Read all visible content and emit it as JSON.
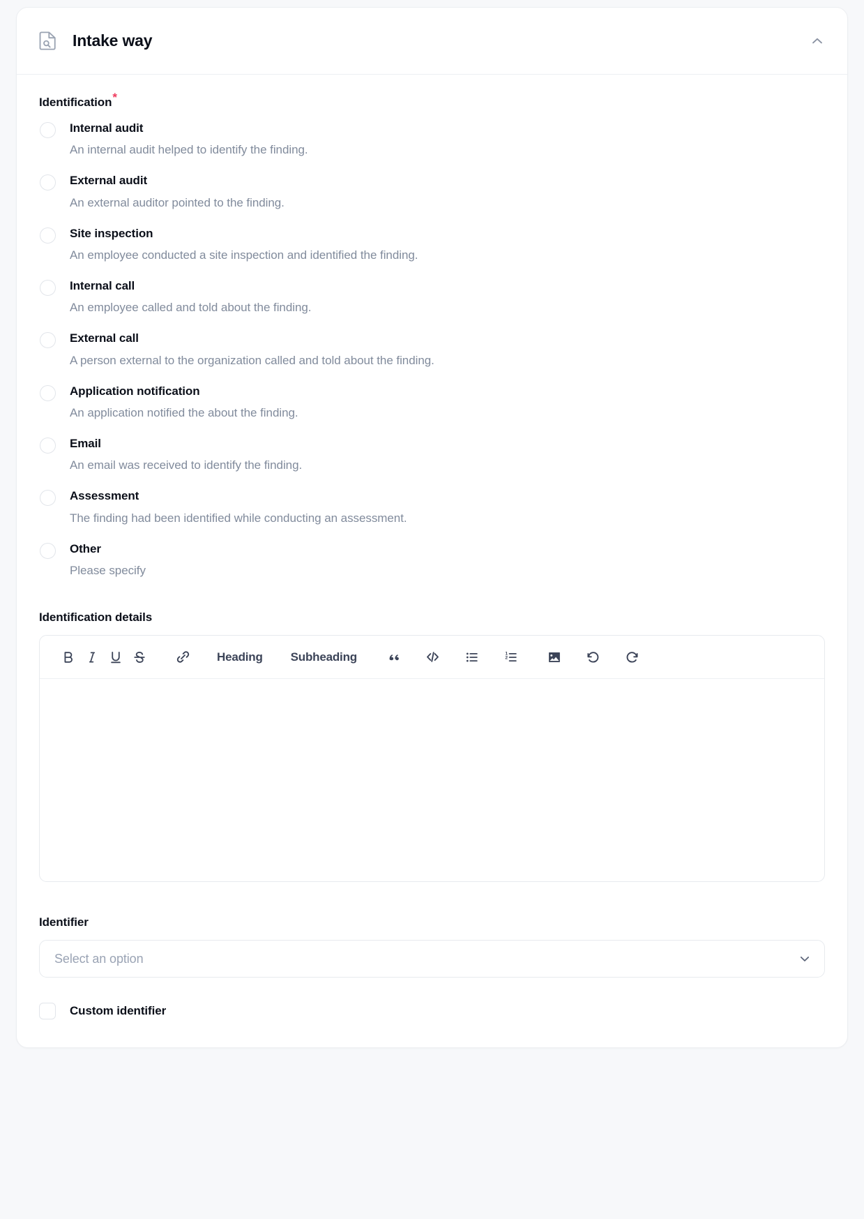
{
  "colors": {
    "page_background": "#f7f8fa",
    "card_background": "#ffffff",
    "card_border": "#eceef1",
    "title_text": "#0b0f19",
    "description_text": "#818b9c",
    "required_asterisk": "#ef3a5d",
    "placeholder_text": "#9aa3b4",
    "control_border": "#e2e5ea",
    "toolbar_icon": "#3c4458",
    "header_icon": "#9aa3b2"
  },
  "card": {
    "title": "Intake way",
    "doc_icon": "document-search-icon",
    "collapse_icon": "chevron-up-icon"
  },
  "identification": {
    "label": "Identification",
    "required": true,
    "required_marker": "*",
    "selected": null,
    "options": [
      {
        "label": "Internal audit",
        "description": "An internal audit helped to identify the finding.",
        "selected": false
      },
      {
        "label": "External audit",
        "description": "An external auditor pointed to the finding.",
        "selected": false
      },
      {
        "label": "Site inspection",
        "description": "An employee conducted a site inspection and identified the finding.",
        "selected": false
      },
      {
        "label": "Internal call",
        "description": "An employee called and told about the finding.",
        "selected": false
      },
      {
        "label": "External call",
        "description": "A person external to the organization called and told about the finding.",
        "selected": false
      },
      {
        "label": "Application notification",
        "description": "An application notified the about the finding.",
        "selected": false
      },
      {
        "label": "Email",
        "description": "An email was received to identify the finding.",
        "selected": false
      },
      {
        "label": "Assessment",
        "description": "The finding had been identified while conducting an assessment.",
        "selected": false
      },
      {
        "label": "Other",
        "description": "Please specify",
        "selected": false
      }
    ]
  },
  "identification_details": {
    "label": "Identification details",
    "value": "",
    "toolbar": {
      "bold": "B",
      "italic": "I",
      "underline": "U",
      "strikethrough": "S",
      "link_icon": "link-icon",
      "heading": "Heading",
      "subheading": "Subheading",
      "blockquote_icon": "blockquote-icon",
      "code_icon": "code-block-icon",
      "bullet_list_icon": "bullet-list-icon",
      "numbered_list_icon": "numbered-list-icon",
      "image_icon": "image-icon",
      "undo_icon": "undo-icon",
      "redo_icon": "redo-icon"
    }
  },
  "identifier": {
    "label": "Identifier",
    "placeholder": "Select an option",
    "value": "",
    "chevron_icon": "chevron-down-icon"
  },
  "custom_identifier": {
    "label": "Custom identifier",
    "checked": false
  }
}
